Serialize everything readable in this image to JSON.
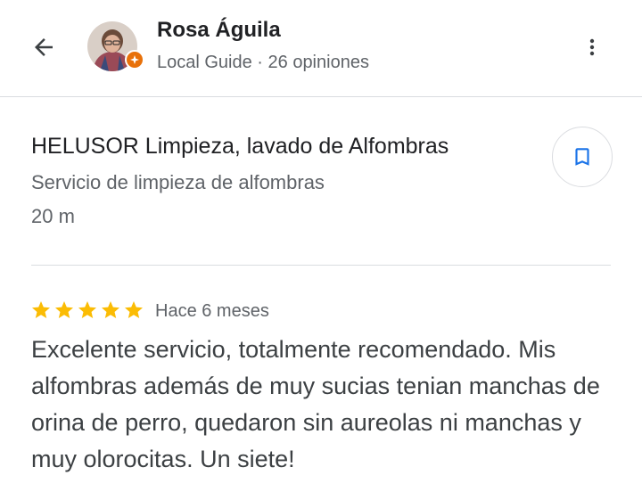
{
  "header": {
    "user_name": "Rosa Águila",
    "user_meta": "Local Guide · 26 opiniones",
    "back_icon": "arrow-back-icon",
    "more_icon": "more-vert-icon",
    "badge_color": "#e8710a"
  },
  "place": {
    "name": "HELUSOR Limpieza, lavado de Alfombras",
    "category": "Servicio de limpieza de alfombras",
    "distance": "20 m",
    "save_icon": "bookmark-icon",
    "accent": "#1a73e8"
  },
  "review": {
    "rating": 5,
    "max_rating": 5,
    "star_color": "#fbbc04",
    "time": "Hace 6 meses",
    "text": "Excelente servicio, totalmente recomendado. Mis alfombras además de muy sucias tenian manchas de orina de perro, quedaron sin aureolas ni manchas y muy olorocitas. Un siete!"
  }
}
